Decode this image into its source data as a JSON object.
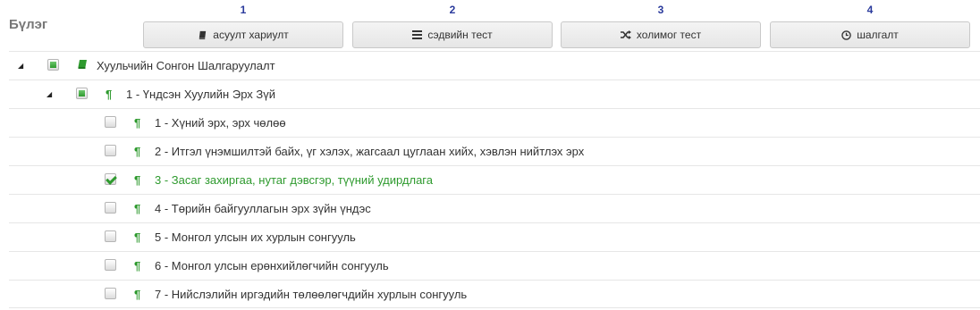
{
  "section": {
    "title": "Бүлэг"
  },
  "modes": [
    {
      "number": "1",
      "label": "асуулт хариулт",
      "icon": "book-icon"
    },
    {
      "number": "2",
      "label": "сэдвийн тест",
      "icon": "list-icon"
    },
    {
      "number": "3",
      "label": "холимог тест",
      "icon": "shuffle-icon"
    },
    {
      "number": "4",
      "label": "шалгалт",
      "icon": "clock-icon"
    }
  ],
  "tree": {
    "root": {
      "label": "Хуульчийн Сонгон Шалгаруулалт",
      "checkbox": "partial",
      "expanded": true,
      "icon": "book-icon"
    },
    "chapter": {
      "label": "1 - Үндсэн Хуулийн Эрх Зүй",
      "checkbox": "partial",
      "expanded": true,
      "icon": "paragraph-icon"
    },
    "topics": [
      {
        "label": "1 - Хүний эрх, эрх чөлөө",
        "checked": false
      },
      {
        "label": "2 - Итгэл үнэмшилтэй байх, үг хэлэх, жагсаал цуглаан хийх, хэвлэн нийтлэх эрх",
        "checked": false
      },
      {
        "label": "3 - Засаг захиргаа, нутаг дэвсгэр, түүний удирдлага",
        "checked": true
      },
      {
        "label": "4 - Төрийн байгууллагын эрх зүйн үндэс",
        "checked": false
      },
      {
        "label": "5 - Монгол улсын их хурлын сонгууль",
        "checked": false
      },
      {
        "label": "6 - Монгол улсын ерөнхийлөгчийн сонгууль",
        "checked": false
      },
      {
        "label": "7 - Нийслэлийн иргэдийн төлөөлөгчдийн хурлын сонгууль",
        "checked": false
      }
    ]
  },
  "colors": {
    "accent": "#2e9a2e",
    "number": "#2a3a9c",
    "title": "#777777"
  }
}
